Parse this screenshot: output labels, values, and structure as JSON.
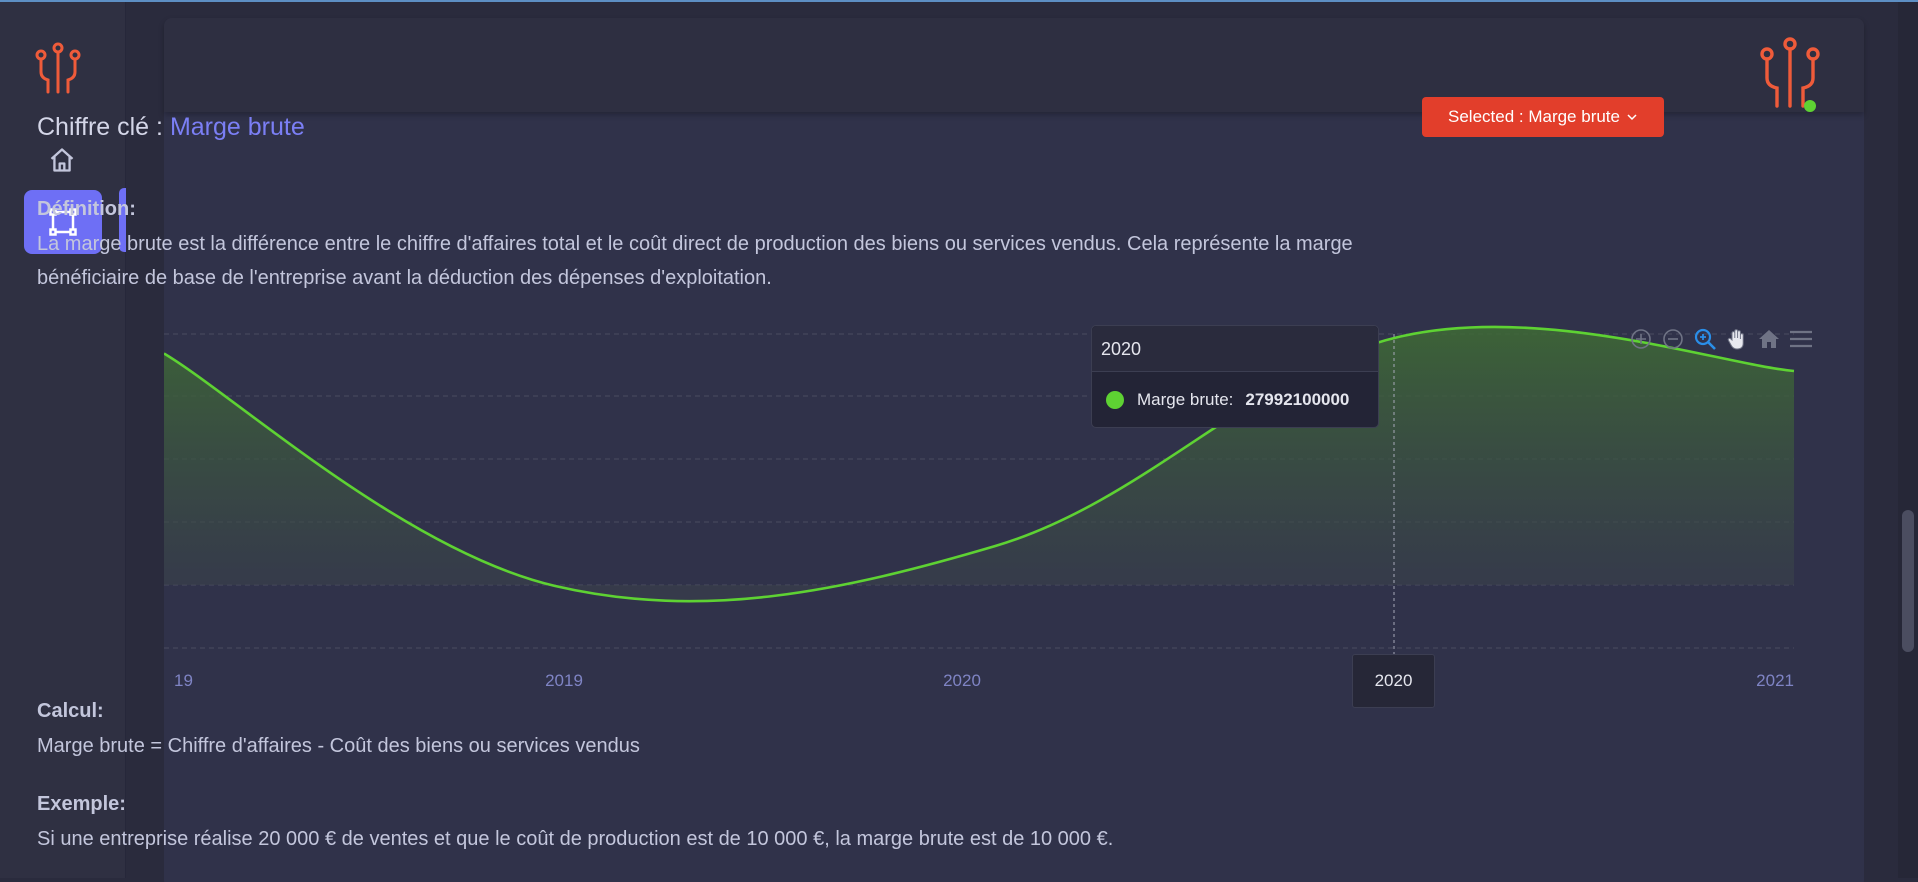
{
  "header": {
    "title_prefix": "Chiffre clé :",
    "title_value": "Marge brute",
    "selected_label": "Selected : Marge brute"
  },
  "definition": {
    "label": "Définition:",
    "line1": "La marge brute est la différence entre le chiffre d'affaires total et le coût direct de production des biens ou services vendus. Cela représente la marge",
    "line2": "bénéficiaire de base de l'entreprise avant la déduction des dépenses d'exploitation."
  },
  "calcul": {
    "label": "Calcul:",
    "text": "Marge brute = Chiffre d'affaires - Coût des biens ou services vendus"
  },
  "exemple": {
    "label": "Exemple:",
    "text": "Si une entreprise réalise 20 000 € de ventes et que le coût de production est de 10 000 €, la marge brute est de 10 000 €."
  },
  "tooltip": {
    "title": "2020",
    "series": "Marge brute:",
    "value": "27992100000"
  },
  "crosshair_label": "2020",
  "toolbar": {
    "icons": [
      "zoom-in-icon",
      "zoom-out-icon",
      "selection-zoom-icon",
      "pan-hand-icon",
      "reset-home-icon",
      "menu-icon"
    ]
  },
  "chart_data": {
    "type": "area",
    "x_ticks": [
      "19",
      "2019",
      "2020",
      "2021"
    ],
    "series": [
      {
        "name": "Marge brute",
        "color": "#5ed233",
        "points": [
          0.93,
          0.0,
          0.16,
          1.0,
          0.86
        ]
      }
    ],
    "highlighted_point": {
      "x": "2020",
      "value": 27992100000
    },
    "grid": "dashed-horizontal"
  },
  "colors": {
    "accent": "#6e6ff5",
    "danger": "#e23e2b",
    "series": "#5ed233"
  }
}
